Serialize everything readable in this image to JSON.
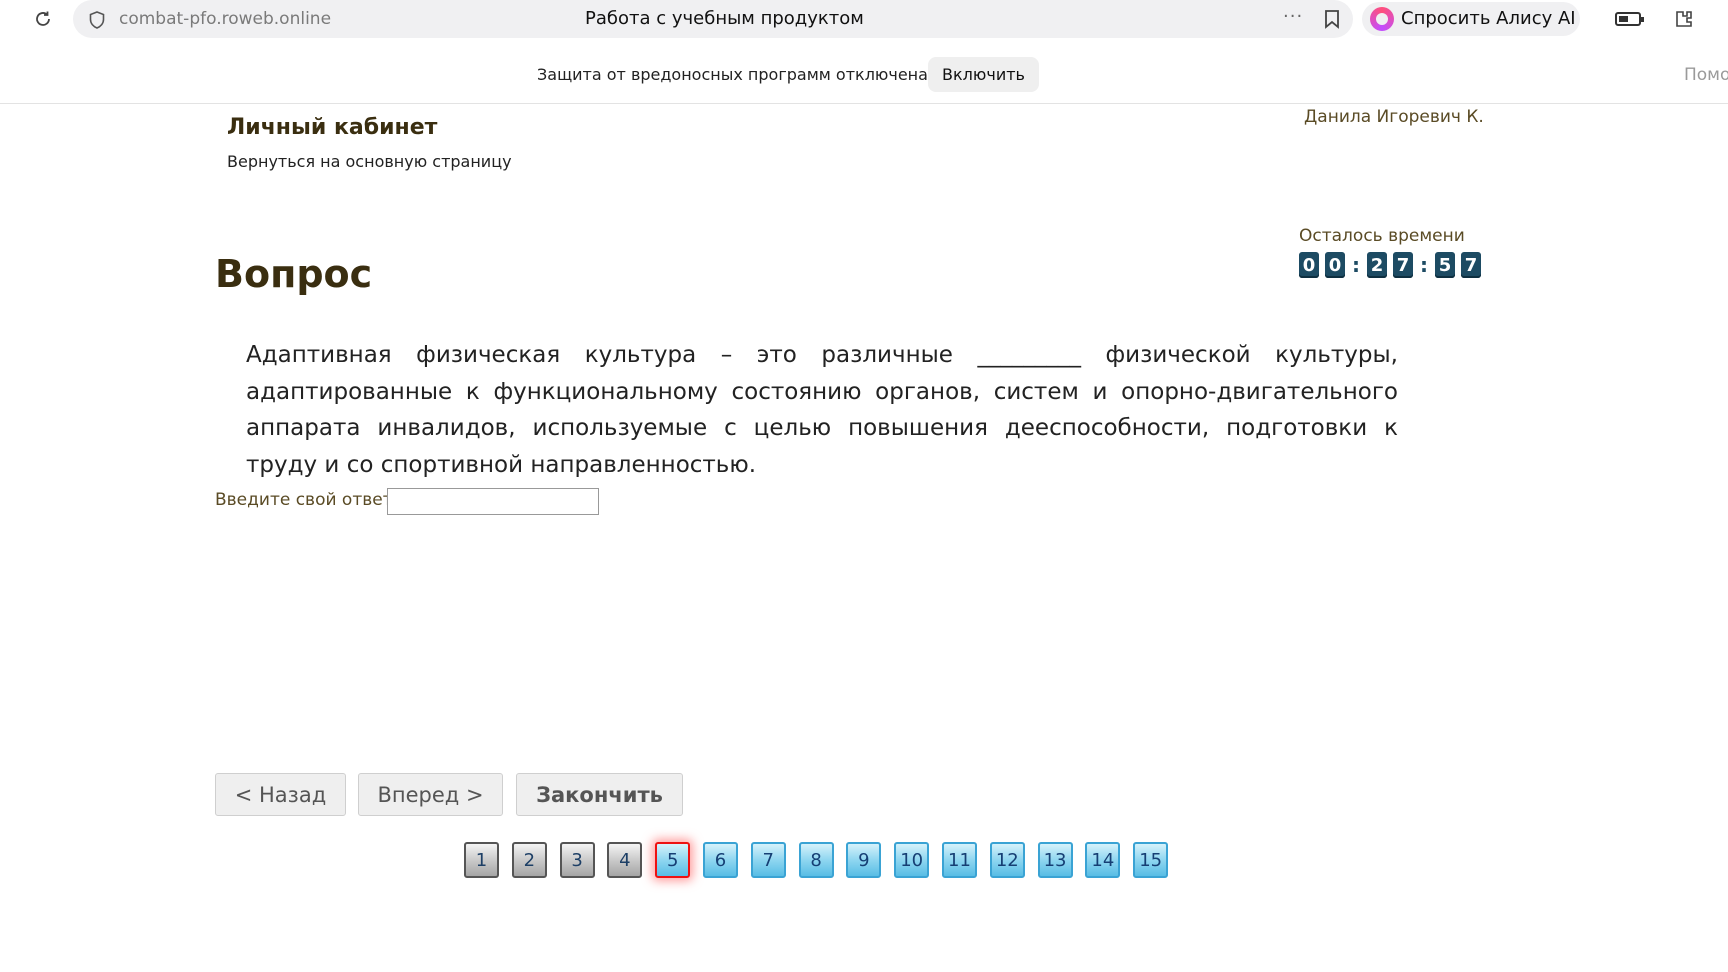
{
  "browser": {
    "url": "combat-pfo.roweb.online",
    "tab_title": "Работа с учебным продуктом",
    "more_label": "···",
    "alice_label": "Спросить Алису AI"
  },
  "infobar": {
    "message": "Защита от вредоносных программ отключена",
    "enable_label": "Включить",
    "help_label": "Помощь"
  },
  "header": {
    "title": "Личный кабинет",
    "back_link": "Вернуться на основную страницу",
    "user_name": "Данила Игоревич К."
  },
  "timer": {
    "label": "Осталось времени",
    "digits": [
      "0",
      "0",
      "2",
      "7",
      "5",
      "7"
    ],
    "separator": ":"
  },
  "question": {
    "heading": "Вопрос",
    "text": "Адаптивная физическая культура – это различные _________ физической культуры, адаптированные к функциональному состоянию органов, систем и опорно-двигательного аппарата инвалидов, используемые с целью повышения дееспособности, подготовки к труду и со спортивной направленностью.",
    "answer_label": "Введите свой ответ",
    "answer_value": ""
  },
  "navigation": {
    "back_label": "< Назад",
    "next_label": "Вперед >",
    "finish_label": "Закончить"
  },
  "pagination": {
    "pages": [
      {
        "label": "1",
        "state": "done"
      },
      {
        "label": "2",
        "state": "done"
      },
      {
        "label": "3",
        "state": "done"
      },
      {
        "label": "4",
        "state": "done"
      },
      {
        "label": "5",
        "state": "current"
      },
      {
        "label": "6",
        "state": "todo"
      },
      {
        "label": "7",
        "state": "todo"
      },
      {
        "label": "8",
        "state": "todo"
      },
      {
        "label": "9",
        "state": "todo"
      },
      {
        "label": "10",
        "state": "todo"
      },
      {
        "label": "11",
        "state": "todo"
      },
      {
        "label": "12",
        "state": "todo"
      },
      {
        "label": "13",
        "state": "todo"
      },
      {
        "label": "14",
        "state": "todo"
      },
      {
        "label": "15",
        "state": "todo"
      }
    ]
  },
  "colors": {
    "heading": "#3a2e10",
    "timer_digit_bg": "#1d4b63",
    "current_page_border": "#ee1111",
    "todo_page_bg": "#8fd6f0"
  }
}
